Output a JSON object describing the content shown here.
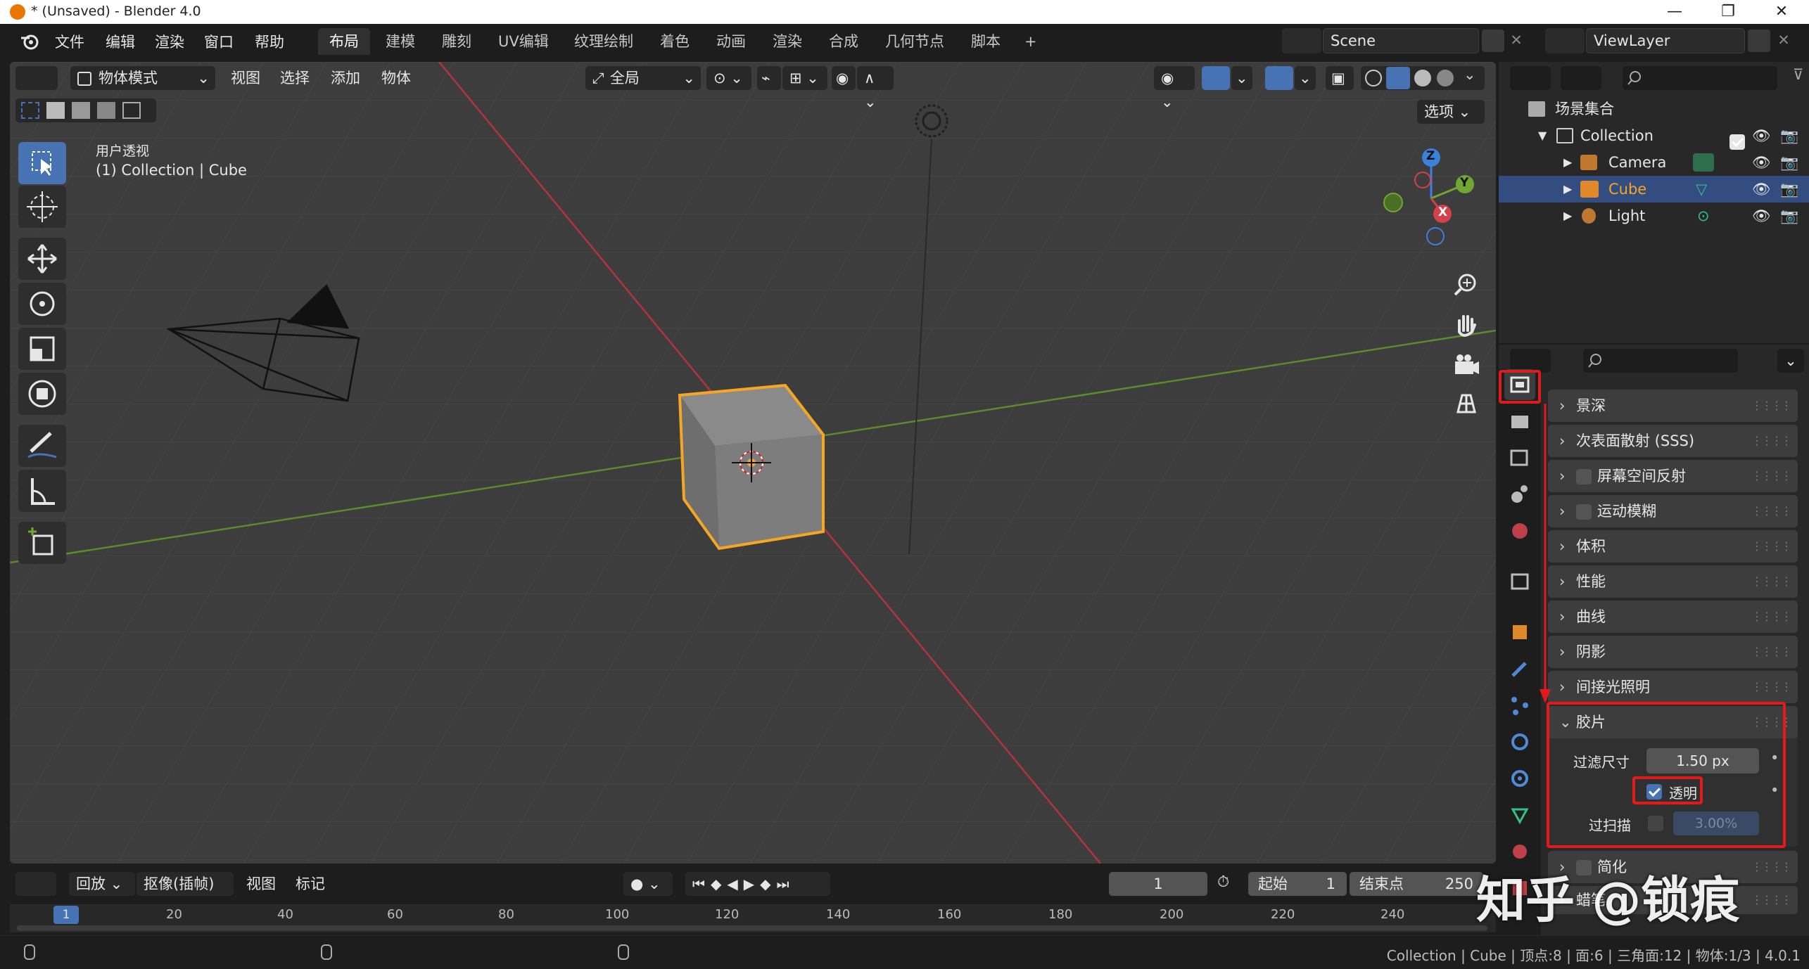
{
  "window": {
    "title": "* (Unsaved) - Blender 4.0",
    "minimize": "—",
    "maximize": "❐",
    "close": "✕"
  },
  "menu": [
    "文件",
    "编辑",
    "渲染",
    "窗口",
    "帮助"
  ],
  "workspaces": [
    "布局",
    "建模",
    "雕刻",
    "UV编辑",
    "纹理绘制",
    "着色",
    "动画",
    "渲染",
    "合成",
    "几何节点",
    "脚本"
  ],
  "add_workspace": "+",
  "scene": {
    "value": "Scene"
  },
  "view_layer": {
    "value": "ViewLayer"
  },
  "viewport_header": {
    "mode": "物体模式",
    "menus": [
      "视图",
      "选择",
      "添加",
      "物体"
    ],
    "transform_orientation": "全局",
    "options": "选项"
  },
  "viewport": {
    "view_name": "用户透视",
    "context": "(1) Collection | Cube",
    "gizmo_axes": {
      "z": "Z",
      "y": "Y",
      "x": "X"
    }
  },
  "outliner": {
    "root": "场景集合",
    "items": [
      {
        "label": "Collection",
        "level": 1
      },
      {
        "label": "Camera",
        "level": 2
      },
      {
        "label": "Cube",
        "level": 2,
        "selected": true
      },
      {
        "label": "Light",
        "level": 2
      }
    ]
  },
  "properties": {
    "panels": [
      "景深",
      "次表面散射 (SSS)",
      "屏幕空间反射",
      "运动模糊",
      "体积",
      "性能",
      "曲线",
      "阴影",
      "间接光照明"
    ],
    "film_panel": {
      "title": "胶片",
      "filter_size_label": "过滤尺寸",
      "filter_size_value": "1.50 px",
      "transparent_label": "透明",
      "transparent_checked": true,
      "overscan_label": "过扫描",
      "overscan_value": "3.00%"
    },
    "after_panels": [
      "简化",
      "蜡笔"
    ]
  },
  "timeline": {
    "playback": "回放",
    "keying": "抠像(插帧)",
    "view": "视图",
    "marker": "标记",
    "current_frame": "1",
    "start_label": "起始",
    "start_value": "1",
    "end_label": "结束点",
    "end_value": "250",
    "ruler": [
      "1",
      "20",
      "40",
      "60",
      "80",
      "100",
      "120",
      "140",
      "160",
      "180",
      "200",
      "220",
      "240"
    ]
  },
  "status": {
    "text": "Collection | Cube | 顶点:8 | 面:6 | 三角面:12 | 物体:1/3 | 4.0.1"
  },
  "watermark": "知乎 @锁痕",
  "colors": {
    "accent": "#4772b3",
    "selection_orange": "#f5a623",
    "highlight_red": "#e11b1b",
    "x_axis": "#d4414a",
    "y_axis": "#6ea832",
    "z_axis": "#3b80d9"
  }
}
